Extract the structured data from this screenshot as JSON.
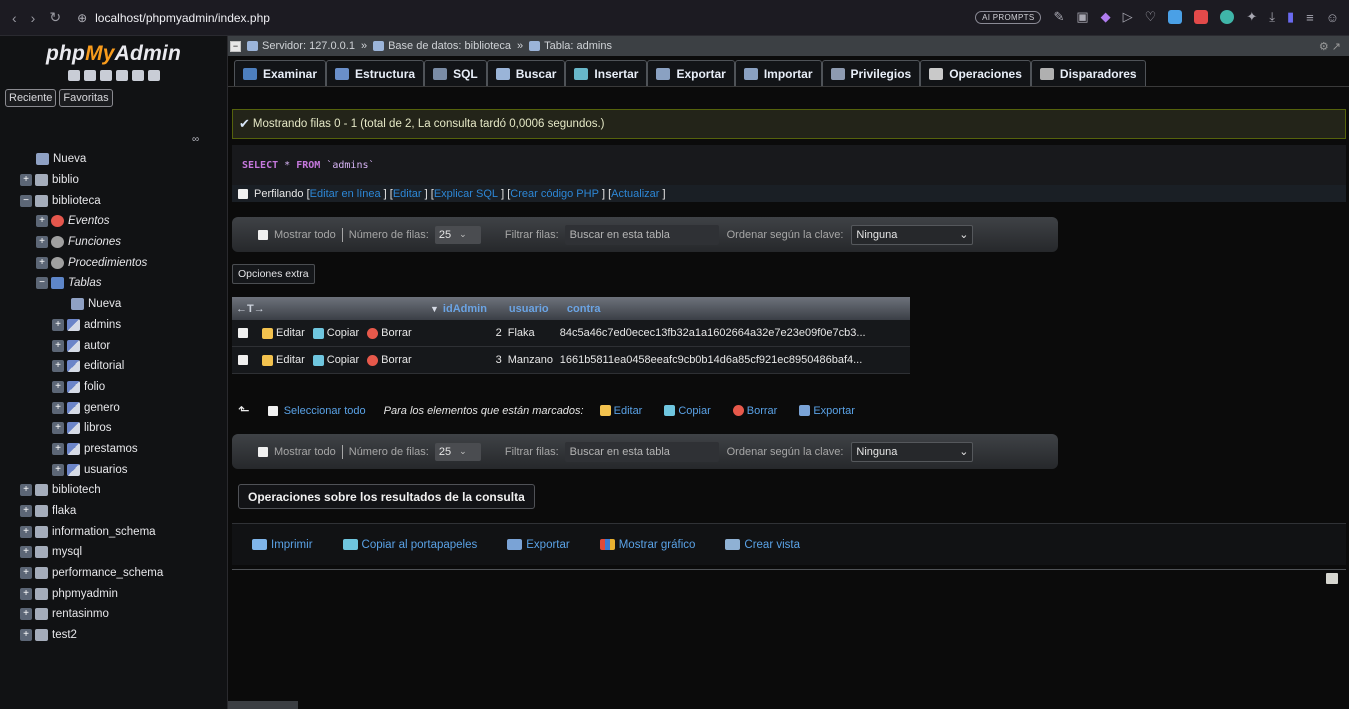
{
  "browser": {
    "url": "localhost/phpmyadmin/index.php",
    "ai_prompts": "AI PROMPTS"
  },
  "sidebar": {
    "logo_php": "php",
    "logo_my": "My",
    "logo_admin": "Admin",
    "tabs": [
      "Reciente",
      "Favoritas"
    ],
    "tree": [
      {
        "label": "Nueva",
        "level": 0,
        "kind": "new"
      },
      {
        "label": "biblio",
        "level": 0,
        "kind": "db"
      },
      {
        "label": "biblioteca",
        "level": 0,
        "kind": "db",
        "expanded": true
      },
      {
        "label": "Eventos",
        "level": 1,
        "kind": "ev",
        "italic": true
      },
      {
        "label": "Funciones",
        "level": 1,
        "kind": "fn",
        "italic": true
      },
      {
        "label": "Procedimientos",
        "level": 1,
        "kind": "fn",
        "italic": true
      },
      {
        "label": "Tablas",
        "level": 1,
        "kind": "tbls",
        "italic": true,
        "expanded": true
      },
      {
        "label": "Nueva",
        "level": 2,
        "kind": "new"
      },
      {
        "label": "admins",
        "level": 2,
        "kind": "tbl"
      },
      {
        "label": "autor",
        "level": 2,
        "kind": "tbl"
      },
      {
        "label": "editorial",
        "level": 2,
        "kind": "tbl"
      },
      {
        "label": "folio",
        "level": 2,
        "kind": "tbl"
      },
      {
        "label": "genero",
        "level": 2,
        "kind": "tbl"
      },
      {
        "label": "libros",
        "level": 2,
        "kind": "tbl"
      },
      {
        "label": "prestamos",
        "level": 2,
        "kind": "tbl"
      },
      {
        "label": "usuarios",
        "level": 2,
        "kind": "tbl"
      },
      {
        "label": "bibliotech",
        "level": 0,
        "kind": "db"
      },
      {
        "label": "flaka",
        "level": 0,
        "kind": "db"
      },
      {
        "label": "information_schema",
        "level": 0,
        "kind": "db"
      },
      {
        "label": "mysql",
        "level": 0,
        "kind": "db"
      },
      {
        "label": "performance_schema",
        "level": 0,
        "kind": "db"
      },
      {
        "label": "phpmyadmin",
        "level": 0,
        "kind": "db"
      },
      {
        "label": "rentasinmo",
        "level": 0,
        "kind": "db"
      },
      {
        "label": "test2",
        "level": 0,
        "kind": "db"
      }
    ]
  },
  "breadcrumb": {
    "server": "Servidor: 127.0.0.1",
    "database": "Base de datos: biblioteca",
    "table": "Tabla: admins",
    "sep": "»"
  },
  "tabs": [
    {
      "label": "Examinar",
      "color": "#4d7fbf"
    },
    {
      "label": "Estructura",
      "color": "#6a8fc9"
    },
    {
      "label": "SQL",
      "color": "#7a8ca5"
    },
    {
      "label": "Buscar",
      "color": "#9ab4d8"
    },
    {
      "label": "Insertar",
      "color": "#68b7c9"
    },
    {
      "label": "Exportar",
      "color": "#8aa1c2"
    },
    {
      "label": "Importar",
      "color": "#8aa1c2"
    },
    {
      "label": "Privilegios",
      "color": "#8d9ab0"
    },
    {
      "label": "Operaciones",
      "color": "#c9c9c9"
    },
    {
      "label": "Disparadores",
      "color": "#b0b0b0"
    }
  ],
  "notice": "Mostrando filas 0 - 1 (total de 2, La consulta tardó 0,0006 segundos.)",
  "sql": {
    "select": "SELECT",
    "star": "*",
    "from": "FROM",
    "table": "`admins`"
  },
  "profile": {
    "label": "Perfilando",
    "links": [
      "Editar en línea",
      "Editar",
      "Explicar SQL",
      "Crear código PHP",
      "Actualizar"
    ]
  },
  "nav": {
    "show_all": "Mostrar todo",
    "rows_label": "Número de filas:",
    "rows_value": "25",
    "filter_label": "Filtrar filas:",
    "filter_placeholder": "Buscar en esta tabla",
    "order_label": "Ordenar según la clave:",
    "order_value": "Ninguna"
  },
  "extra_options": "Opciones extra",
  "table": {
    "arrows": "←T→",
    "columns": [
      "idAdmin",
      "usuario",
      "contra"
    ],
    "actions": [
      "Editar",
      "Copiar",
      "Borrar"
    ],
    "rows": [
      {
        "id": "2",
        "usuario": "Flaka",
        "contra": "84c5a46c7ed0ecec13fb32a1a1602664a32e7e23e09f0e7cb3..."
      },
      {
        "id": "3",
        "usuario": "Manzano",
        "contra": "1661b5811ea0458eeafc9cb0b14d6a85cf921ec8950486baf4..."
      }
    ]
  },
  "mass": {
    "select_all": "Seleccionar todo",
    "marked_label": "Para los elementos que están marcados:",
    "edit": "Editar",
    "copy": "Copiar",
    "delete": "Borrar",
    "export": "Exportar"
  },
  "ops": {
    "title": "Operaciones sobre los resultados de la consulta",
    "items": [
      "Imprimir",
      "Copiar al portapapeles",
      "Exportar",
      "Mostrar gráfico",
      "Crear vista"
    ]
  }
}
